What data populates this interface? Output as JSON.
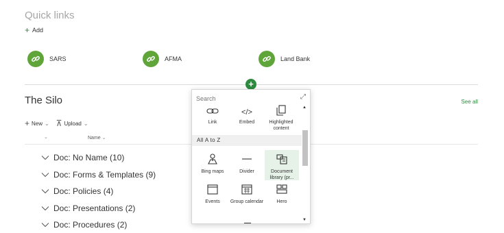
{
  "quick_links": {
    "title": "Quick links",
    "add_label": "Add",
    "items": [
      {
        "label": "SARS"
      },
      {
        "label": "AFMA"
      },
      {
        "label": "Land Bank"
      }
    ]
  },
  "silo": {
    "title": "The Silo",
    "see_all": "See all",
    "toolbar": {
      "new_label": "New",
      "upload_label": "Upload"
    },
    "column_name": "Name",
    "groups": [
      "Doc: No Name (10)",
      "Doc: Forms & Templates (9)",
      "Doc: Policies (4)",
      "Doc: Presentations (2)",
      "Doc: Procedures (2)"
    ]
  },
  "webpart_picker": {
    "search_placeholder": "Search",
    "section_header": "All A to Z",
    "top_tiles": [
      "Link",
      "Embed",
      "Highlighted content"
    ],
    "az_tiles": [
      "Bing maps",
      "Divider",
      "Document library (pr...",
      "Events",
      "Group calendar",
      "Hero"
    ],
    "selected_tile": "Document library (pr..."
  },
  "colors": {
    "accent": "#2d8a3e",
    "quicklink_icon": "#5fa53a",
    "selected_tile_bg": "#e6f2e7"
  }
}
